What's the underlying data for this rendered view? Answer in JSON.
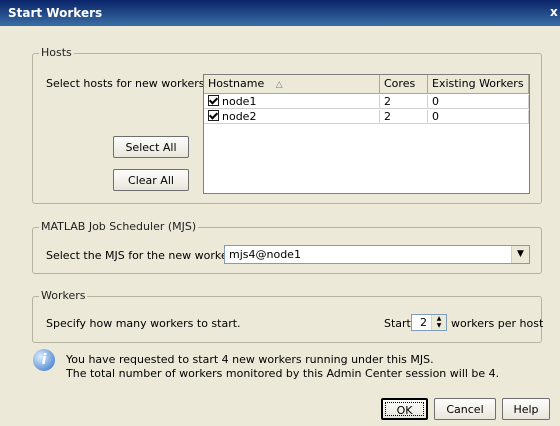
{
  "window": {
    "title": "Start Workers",
    "close_glyph": "x"
  },
  "hosts": {
    "legend": "Hosts",
    "prompt": "Select hosts for new workers.",
    "select_all": "Select All",
    "clear_all": "Clear All",
    "columns": [
      "Hostname",
      "Cores",
      "Existing Workers"
    ],
    "sort_glyph": "△",
    "rows": [
      {
        "hostname": "node1",
        "cores": "2",
        "existing_workers": "0",
        "checked": true
      },
      {
        "hostname": "node2",
        "cores": "2",
        "existing_workers": "0",
        "checked": true
      }
    ]
  },
  "mjs": {
    "legend": "MATLAB Job Scheduler (MJS)",
    "prompt": "Select the MJS for the new workers.",
    "selected": "mjs4@node1"
  },
  "workers": {
    "legend": "Workers",
    "prompt": "Specify how many workers to start.",
    "start_label": "Start",
    "count": "2",
    "per_host_label": "workers per host"
  },
  "message": {
    "icon": "info-icon",
    "line1": "You have requested to start 4 new workers running under this MJS.",
    "line2": "The total number of workers monitored by this Admin Center session will be 4."
  },
  "buttons": {
    "ok": "OK",
    "cancel": "Cancel",
    "help": "Help"
  }
}
